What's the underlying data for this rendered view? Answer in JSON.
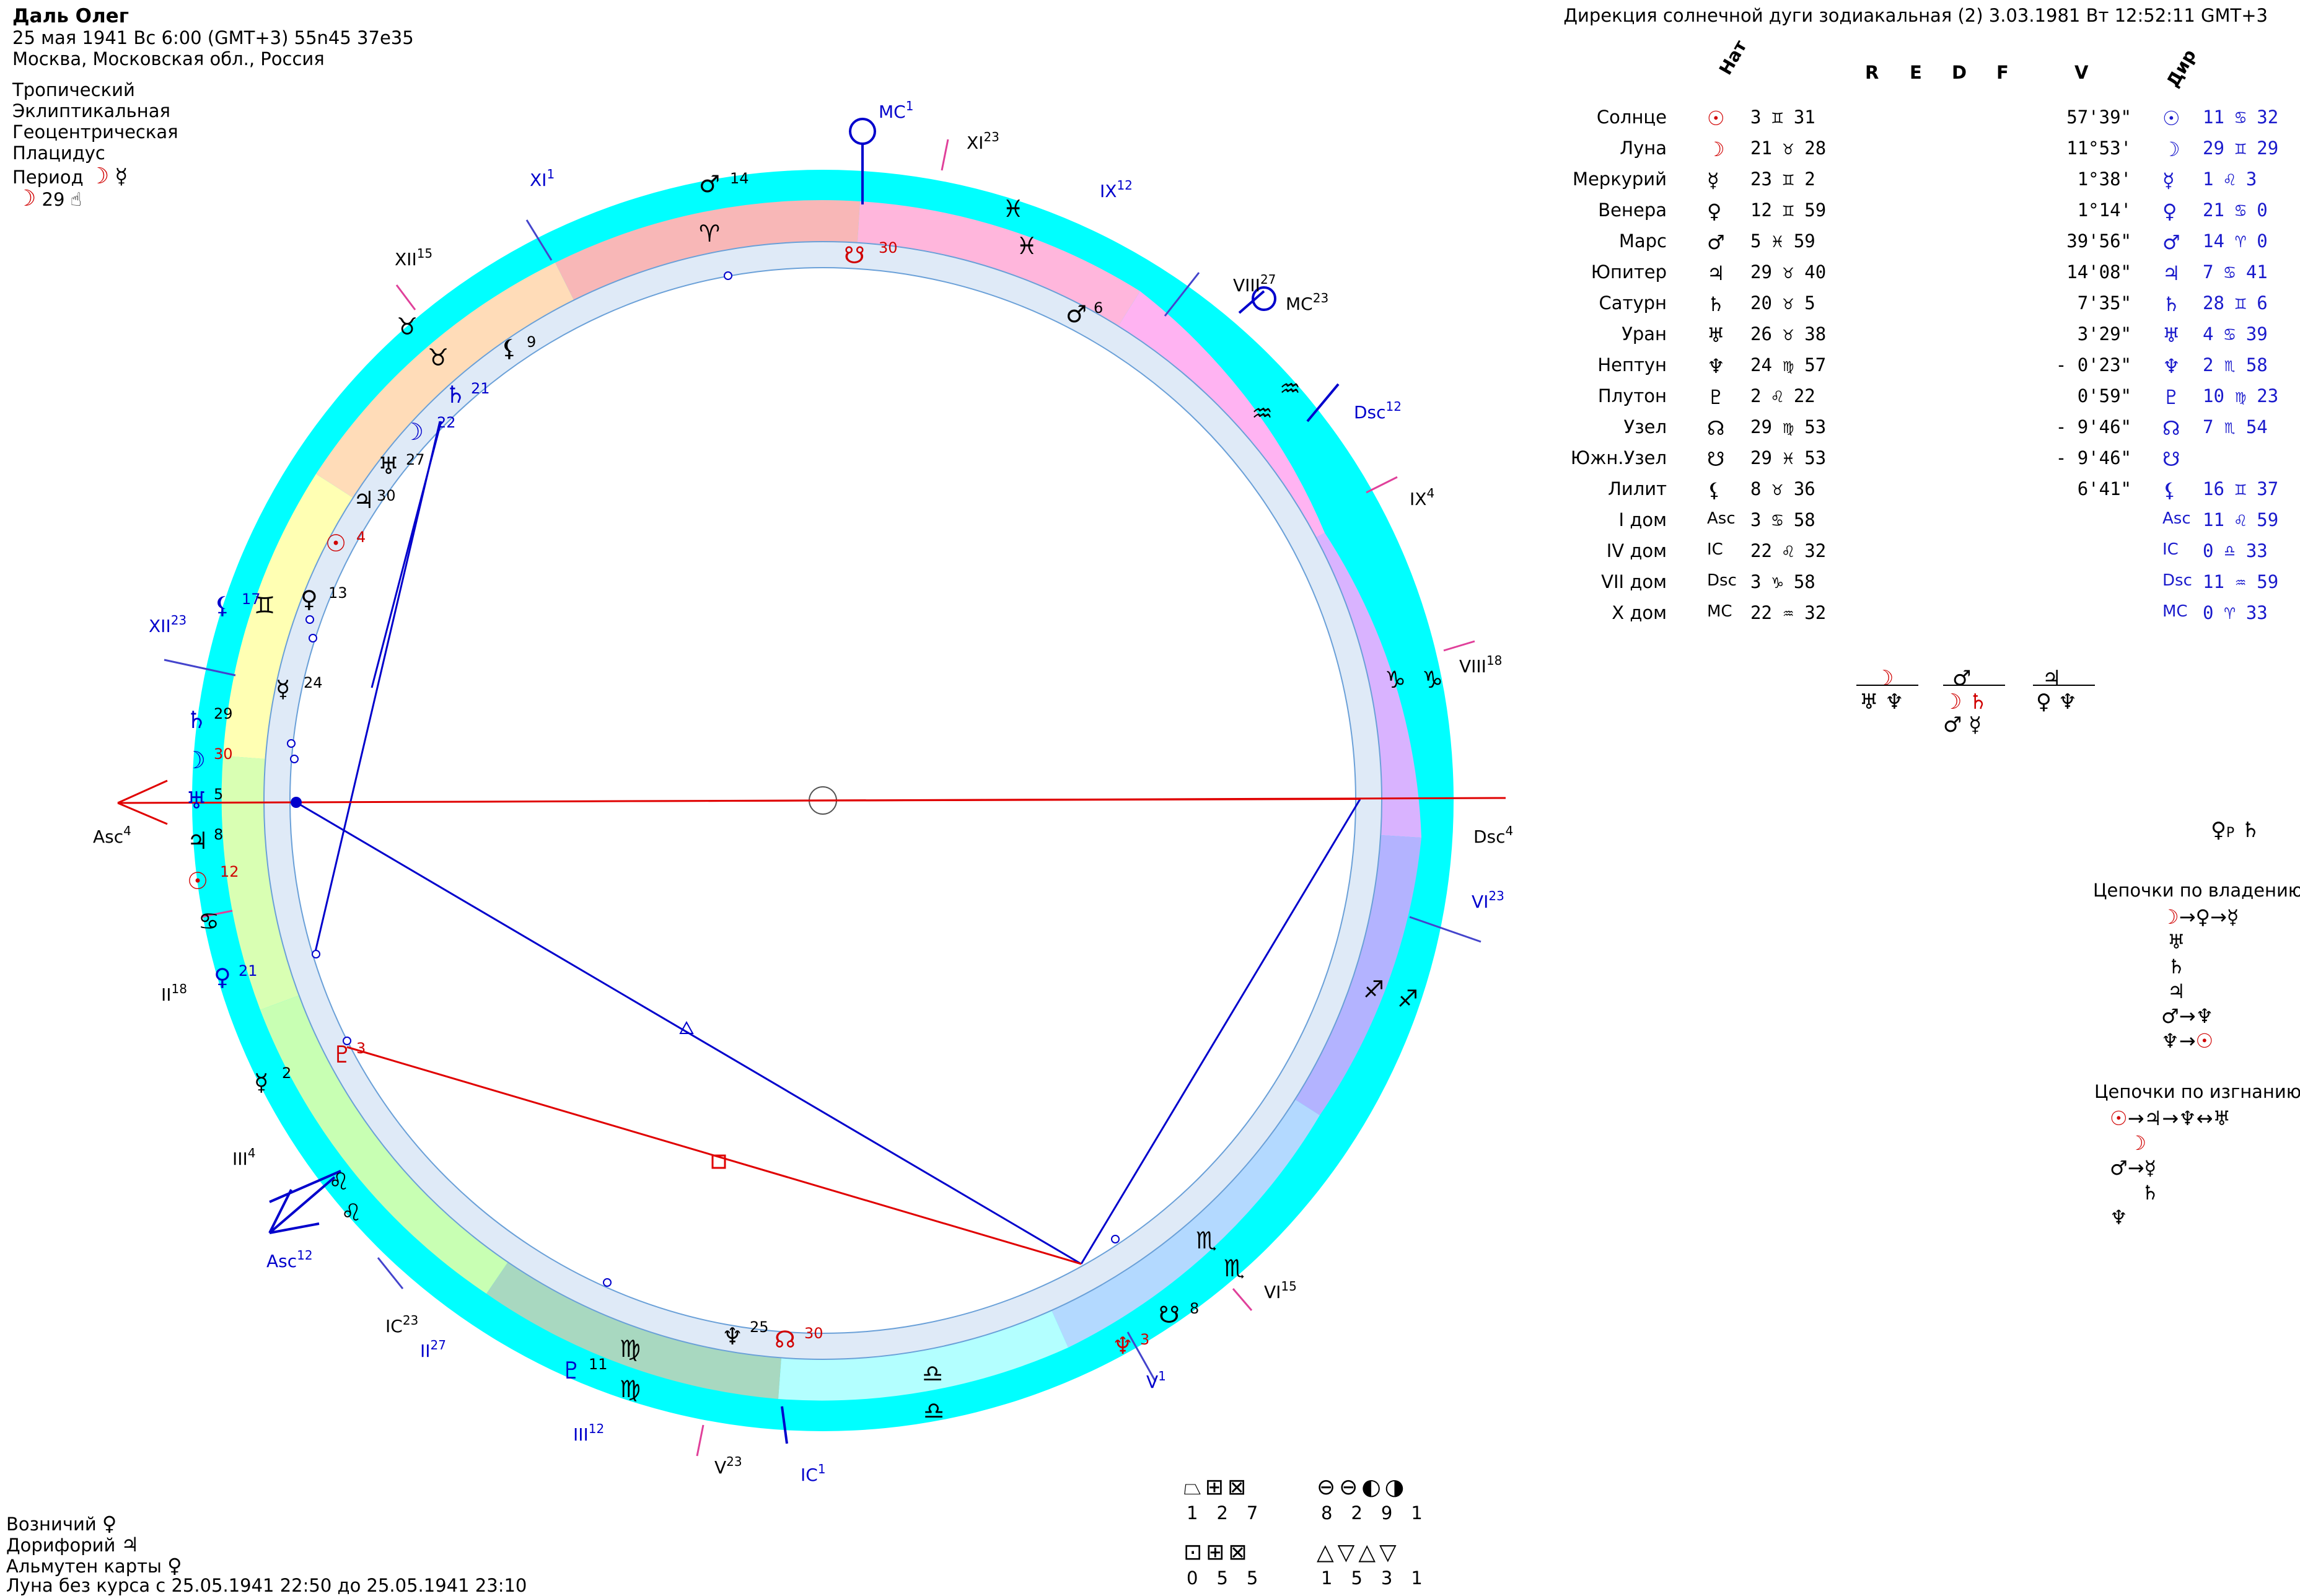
{
  "header": {
    "name": "Даль Олег",
    "line2": "25 мая 1941  Вс   6:00 (GMT+3) 55n45  37e35",
    "line3": "Москва, Московская обл., Россия",
    "settings": [
      "Тропический",
      "Эклиптикальная",
      "Геоцентрическая",
      "Плацидус"
    ],
    "period_label": "Период",
    "period_value": "29",
    "title_right": "Дирекция солнечной дуги зодиакальная (2)  3.03.1981  Вт 12:52:11 GMT+3"
  },
  "table": {
    "col_headers": {
      "nat": "Нат",
      "r": "R",
      "e": "E",
      "d": "D",
      "f": "F",
      "v": "V",
      "dir": "Дир"
    },
    "rows": [
      {
        "name": "Солнце",
        "nat": "3 ♊ 31",
        "v": "57'39\"",
        "dir": "11 ♋ 32"
      },
      {
        "name": "Луна",
        "nat": "21 ♉ 28",
        "v": "11°53'",
        "dir": "29 ♊ 29"
      },
      {
        "name": "Меркурий",
        "nat": "23 ♊ 2",
        "v": "1°38'",
        "dir": "1 ♌ 3"
      },
      {
        "name": "Венера",
        "nat": "12 ♊ 59",
        "v": "1°14'",
        "dir": "21 ♋ 0"
      },
      {
        "name": "Марс",
        "nat": "5 ♓ 59",
        "v": "39'56\"",
        "dir": "14 ♈ 0"
      },
      {
        "name": "Юпитер",
        "nat": "29 ♉ 40",
        "v": "14'08\"",
        "dir": "7 ♋ 41"
      },
      {
        "name": "Сатурн",
        "nat": "20 ♉ 5",
        "v": "7'35\"",
        "dir": "28 ♊ 6"
      },
      {
        "name": "Уран",
        "nat": "26 ♉ 38",
        "v": "3'29\"",
        "dir": "4 ♋ 39"
      },
      {
        "name": "Нептун",
        "nat": "24 ♍ 57",
        "v": "- 0'23\"",
        "dir": "2 ♏ 58"
      },
      {
        "name": "Плутон",
        "nat": "2 ♌ 22",
        "v": "0'59\"",
        "dir": "10 ♍ 23"
      },
      {
        "name": "Узел",
        "nat": "29 ♍ 53",
        "v": "- 9'46\"",
        "dir": "7 ♏ 54"
      },
      {
        "name": "Южн.Узел",
        "nat": "29 ♓ 53",
        "v": "- 9'46\"",
        "dir": ""
      },
      {
        "name": "Лилит",
        "nat": "8 ♉ 36",
        "v": "6'41\"",
        "dir": "16 ♊ 37"
      },
      {
        "name": "I дом",
        "nat": "3 ♋ 58",
        "v": "",
        "dir": "11 ♌ 59"
      },
      {
        "name": "IV дом",
        "nat": "22 ♌ 32",
        "v": "",
        "dir": "0 ♎ 33"
      },
      {
        "name": "VII дом",
        "nat": "3 ♑ 58",
        "v": "",
        "dir": "11 ♒ 59"
      },
      {
        "name": "X дом",
        "nat": "22 ♒ 32",
        "v": "",
        "dir": "0 ♈ 33"
      }
    ]
  },
  "chains": {
    "ownership_title": "Цепочки по владению",
    "exile_title": "Цепочки по изгнанию"
  },
  "footer": {
    "charioteer": "Возничий",
    "doryphory": "Дорифорий",
    "almuten": "Альмутен карты",
    "void_moon": "Луна без курса с 25.05.1941 22:50 до 25.05.1941 23:10"
  },
  "legend_numbers": {
    "row1a": [
      "1",
      "2",
      "7"
    ],
    "row1b": [
      "8",
      "2",
      "9",
      "1"
    ],
    "row2a": [
      "0",
      "5",
      "5"
    ],
    "row2b": [
      "1",
      "5",
      "3",
      "1"
    ]
  },
  "chart_labels": {
    "mc_nat": "MC",
    "mc_nat_sup": "1",
    "mc_dir": "MC",
    "mc_dir_sup": "23",
    "asc_nat": "Asc",
    "asc_nat_sup": "4",
    "asc_dir": "Asc",
    "asc_dir_sup": "12",
    "dsc_nat": "Dsc",
    "dsc_nat_sup": "4",
    "dsc_dir": "Dsc",
    "dsc_dir_sup": "12",
    "ic_nat": "IC",
    "ic_nat_sup": "23",
    "ic_dir": "IC",
    "ic_dir_sup": "1"
  },
  "colors": {
    "outer_ring": "#00ffff",
    "inner_ring": "#dfeaf7",
    "aspect_red": "#e00000",
    "aspect_blue": "#0000cc",
    "directed_blue": "#1a1acc"
  }
}
